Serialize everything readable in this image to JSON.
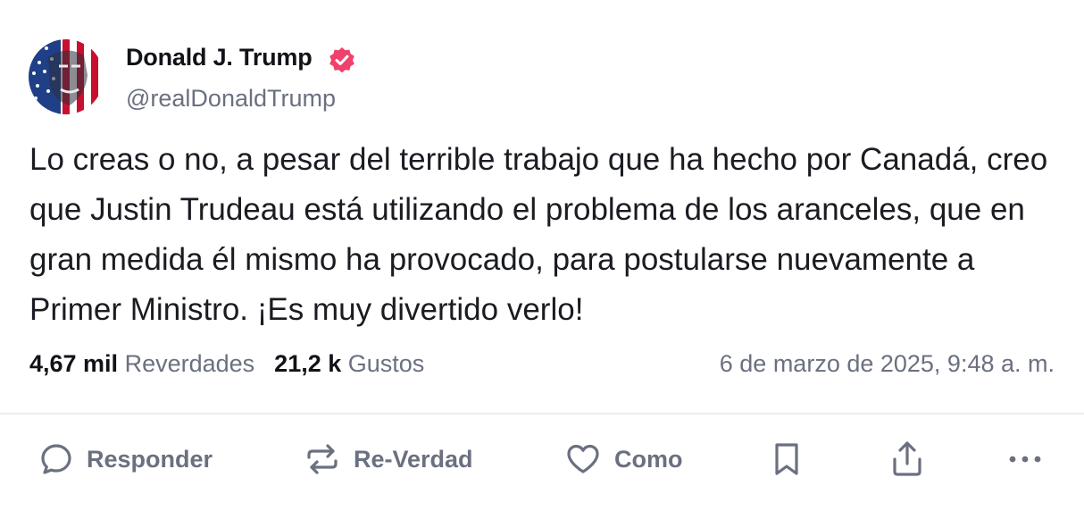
{
  "author": {
    "display_name": "Donald J. Trump",
    "handle": "@realDonaldTrump",
    "verified_color": "#f0416c"
  },
  "post": {
    "text": "Lo creas o no, a pesar del terrible trabajo que ha hecho por Canadá, creo que Justin Trudeau está utilizando el problema de los aranceles, que en gran medida él mismo ha provocado, para postularse nuevamente a Primer Ministro. ¡Es muy divertido verlo!",
    "timestamp": "6 de marzo de 2025, 9:48 a. m."
  },
  "stats": {
    "retruths_count": "4,67 mil",
    "retruths_label": "Reverdades",
    "likes_count": "21,2 k",
    "likes_label": "Gustos"
  },
  "actions": {
    "reply_label": "Responder",
    "retruth_label": "Re-Verdad",
    "like_label": "Como"
  },
  "icons": [
    "reply-icon",
    "retruth-icon",
    "heart-icon",
    "bookmark-icon",
    "share-icon",
    "more-icon",
    "verified-badge-icon"
  ],
  "colors": {
    "text": "#111318",
    "muted": "#6b7080",
    "divider": "#ebecef",
    "verified": "#f0416c"
  }
}
